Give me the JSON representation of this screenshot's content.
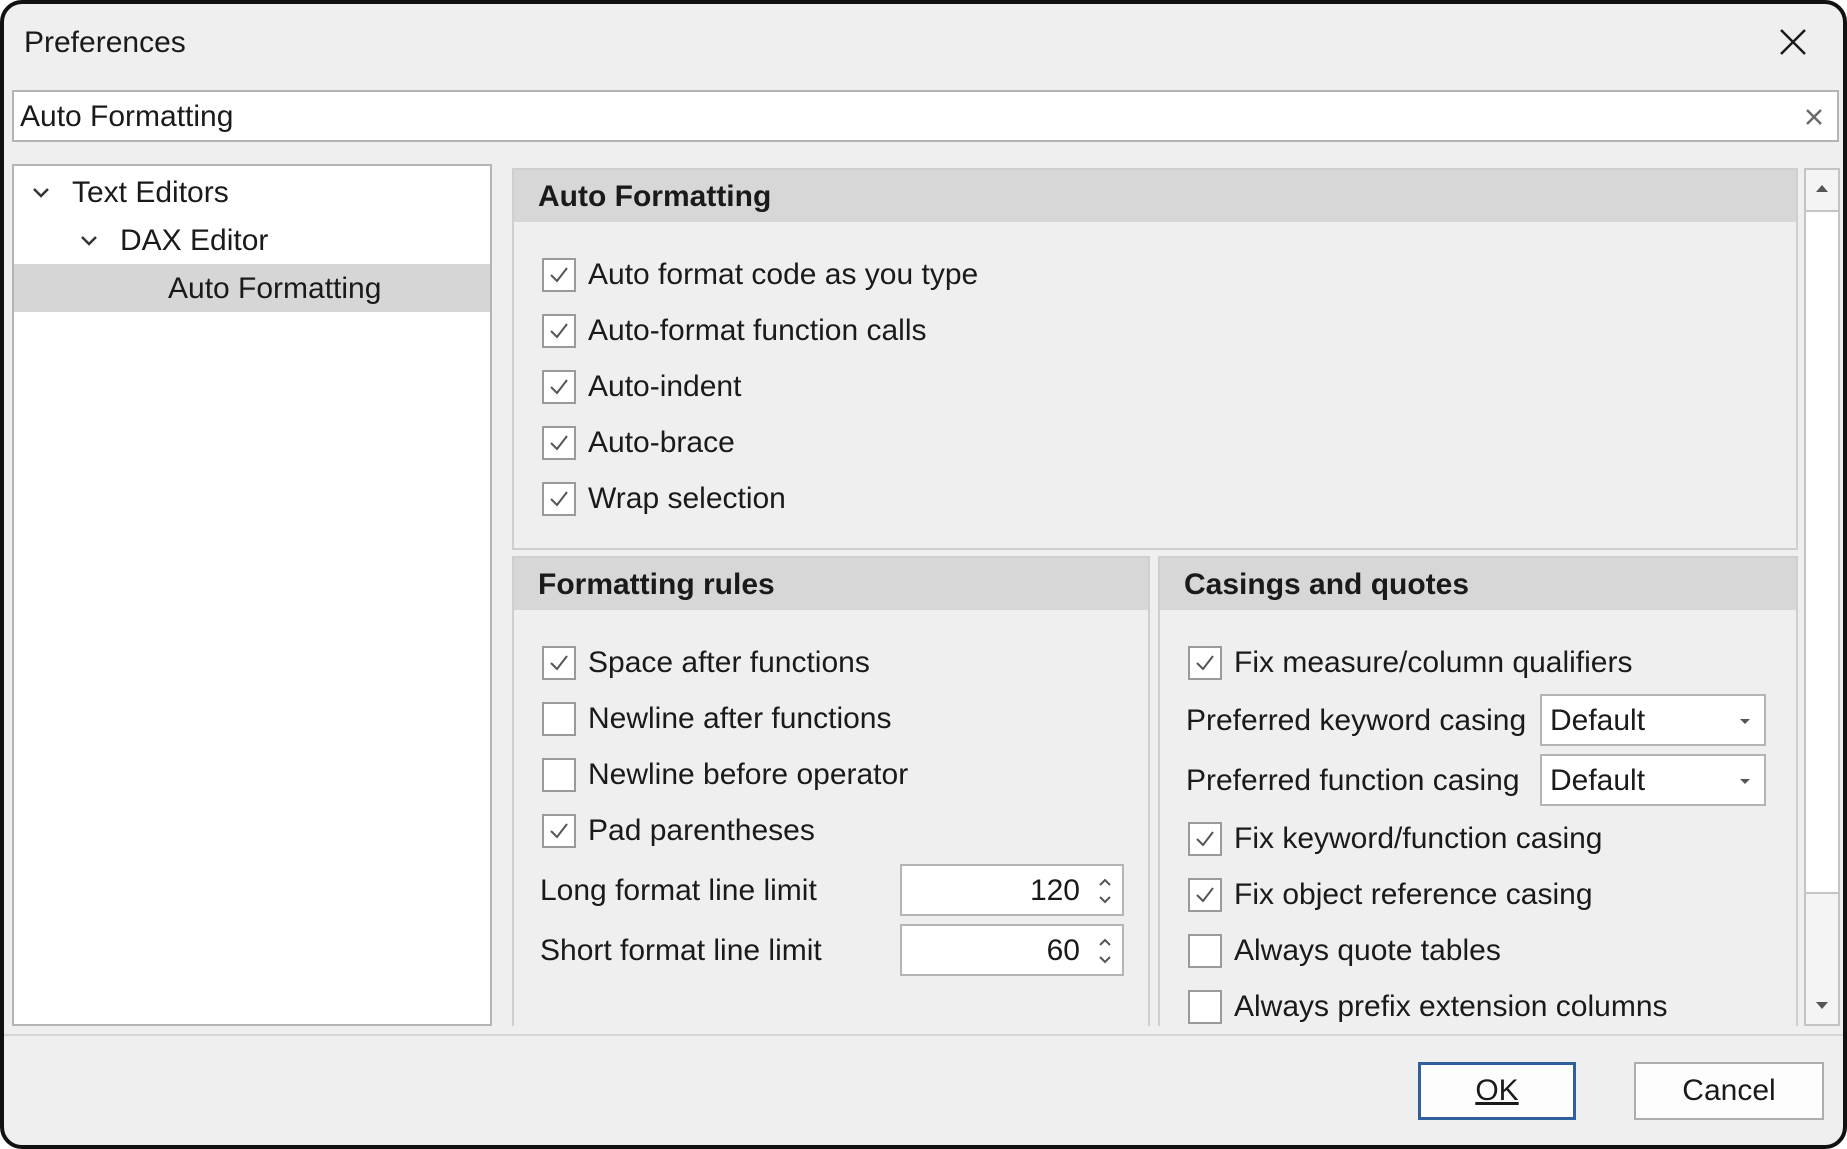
{
  "window": {
    "title": "Preferences",
    "close_icon": "close-icon"
  },
  "search": {
    "value": "Auto Formatting",
    "clear_icon": "clear-icon"
  },
  "tree": {
    "items": [
      {
        "label": "Text Editors",
        "expanded": true,
        "level": 0
      },
      {
        "label": "DAX Editor",
        "expanded": true,
        "level": 1
      },
      {
        "label": "Auto Formatting",
        "selected": true,
        "level": 2
      }
    ]
  },
  "auto_formatting": {
    "header": "Auto Formatting",
    "options": [
      {
        "label": "Auto format code as you type",
        "checked": true
      },
      {
        "label": "Auto-format function calls",
        "checked": true
      },
      {
        "label": "Auto-indent",
        "checked": true
      },
      {
        "label": "Auto-brace",
        "checked": true
      },
      {
        "label": "Wrap selection",
        "checked": true
      }
    ]
  },
  "formatting_rules": {
    "header": "Formatting rules",
    "options": [
      {
        "label": "Space after functions",
        "checked": true
      },
      {
        "label": "Newline after functions",
        "checked": false
      },
      {
        "label": "Newline before operator",
        "checked": false
      },
      {
        "label": "Pad parentheses",
        "checked": true
      }
    ],
    "long_limit": {
      "label": "Long format line limit",
      "value": "120"
    },
    "short_limit": {
      "label": "Short format line limit",
      "value": "60"
    }
  },
  "casings": {
    "header": "Casings and quotes",
    "fix_qualifiers": {
      "label": "Fix measure/column qualifiers",
      "checked": true
    },
    "keyword_casing": {
      "label": "Preferred keyword casing",
      "value": "Default"
    },
    "function_casing": {
      "label": "Preferred function casing",
      "value": "Default"
    },
    "options": [
      {
        "label": "Fix keyword/function casing",
        "checked": true
      },
      {
        "label": "Fix object reference casing",
        "checked": true
      },
      {
        "label": "Always quote tables",
        "checked": false
      },
      {
        "label": "Always prefix extension columns",
        "checked": false
      }
    ]
  },
  "footer": {
    "ok_label": "OK",
    "cancel_label": "Cancel"
  },
  "colors": {
    "window_bg": "#efefef",
    "header_bg": "#d7d7d7",
    "selected_bg": "#d6d6d6",
    "default_button_border": "#2f5f9c"
  }
}
